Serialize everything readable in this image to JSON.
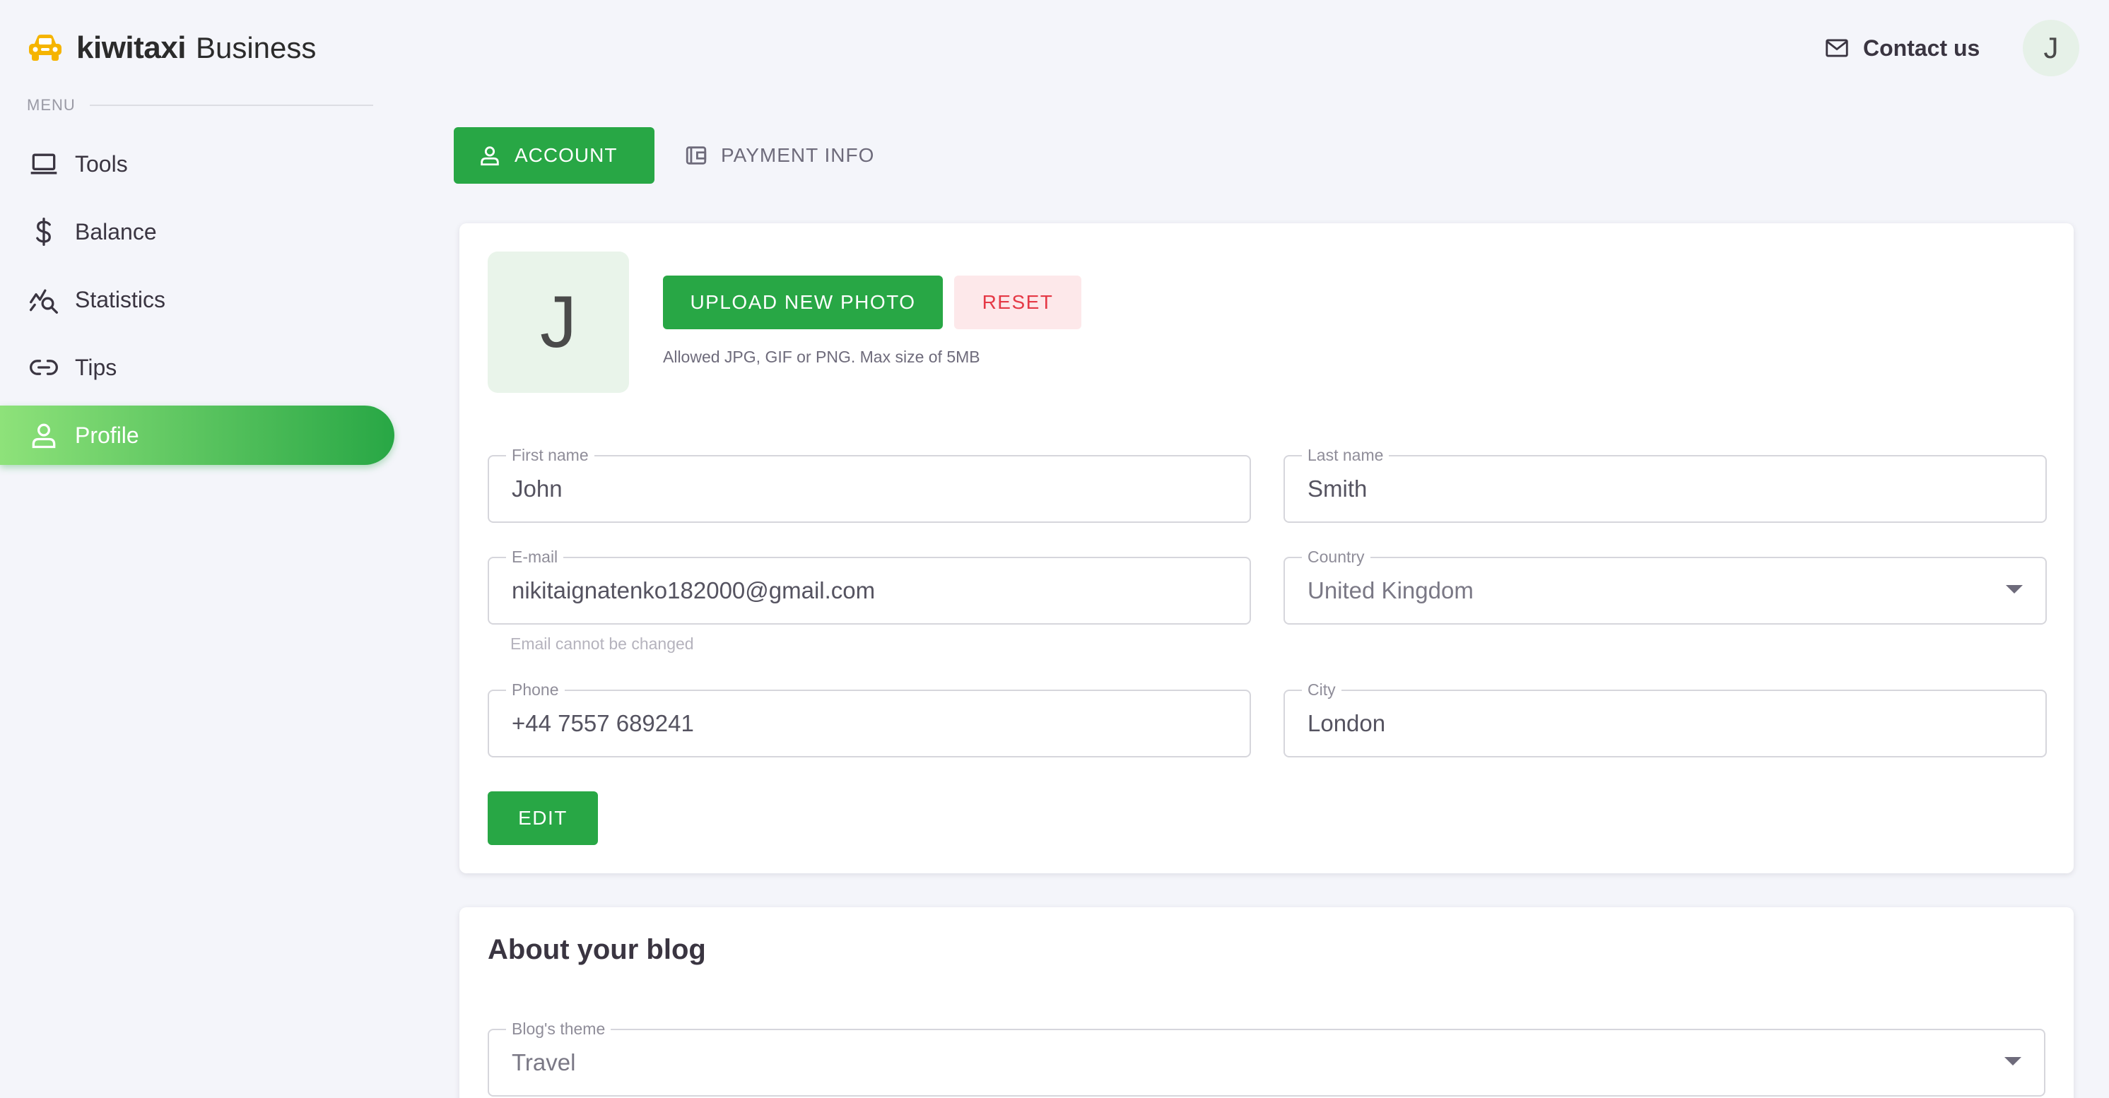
{
  "brand": {
    "name": "kiwitaxi",
    "suffix": "Business"
  },
  "sidebar": {
    "menu_header": "MENU",
    "items": [
      {
        "label": "Tools",
        "icon": "laptop-icon",
        "active": false
      },
      {
        "label": "Balance",
        "icon": "dollar-icon",
        "active": false
      },
      {
        "label": "Statistics",
        "icon": "chart-search-icon",
        "active": false
      },
      {
        "label": "Tips",
        "icon": "link-icon",
        "active": false
      },
      {
        "label": "Profile",
        "icon": "user-icon",
        "active": true
      }
    ]
  },
  "header": {
    "contact_label": "Contact us",
    "avatar_initial": "J"
  },
  "tabs": [
    {
      "label": "ACCOUNT",
      "icon": "user-icon",
      "active": true
    },
    {
      "label": "PAYMENT INFO",
      "icon": "wallet-icon",
      "active": false
    }
  ],
  "account": {
    "avatar_initial": "J",
    "upload_label": "UPLOAD NEW PHOTO",
    "reset_label": "RESET",
    "photo_hint": "Allowed JPG, GIF or PNG. Max size of 5MB",
    "fields": {
      "first_name": {
        "label": "First name",
        "value": "John"
      },
      "last_name": {
        "label": "Last name",
        "value": "Smith"
      },
      "email": {
        "label": "E-mail",
        "value": "nikitaignatenko182000@gmail.com",
        "hint": "Email cannot be changed"
      },
      "country": {
        "label": "Country",
        "value": "United Kingdom"
      },
      "phone": {
        "label": "Phone",
        "value": "+44 7557 689241"
      },
      "city": {
        "label": "City",
        "value": "London"
      }
    },
    "edit_label": "EDIT"
  },
  "blog": {
    "title": "About your blog",
    "theme": {
      "label": "Blog's theme",
      "value": "Travel"
    }
  },
  "colors": {
    "accent": "#28a745",
    "accent_light": "#8ee27a",
    "danger": "#e53946",
    "background": "#f4f5fa",
    "brand_icon": "#f5b400"
  }
}
